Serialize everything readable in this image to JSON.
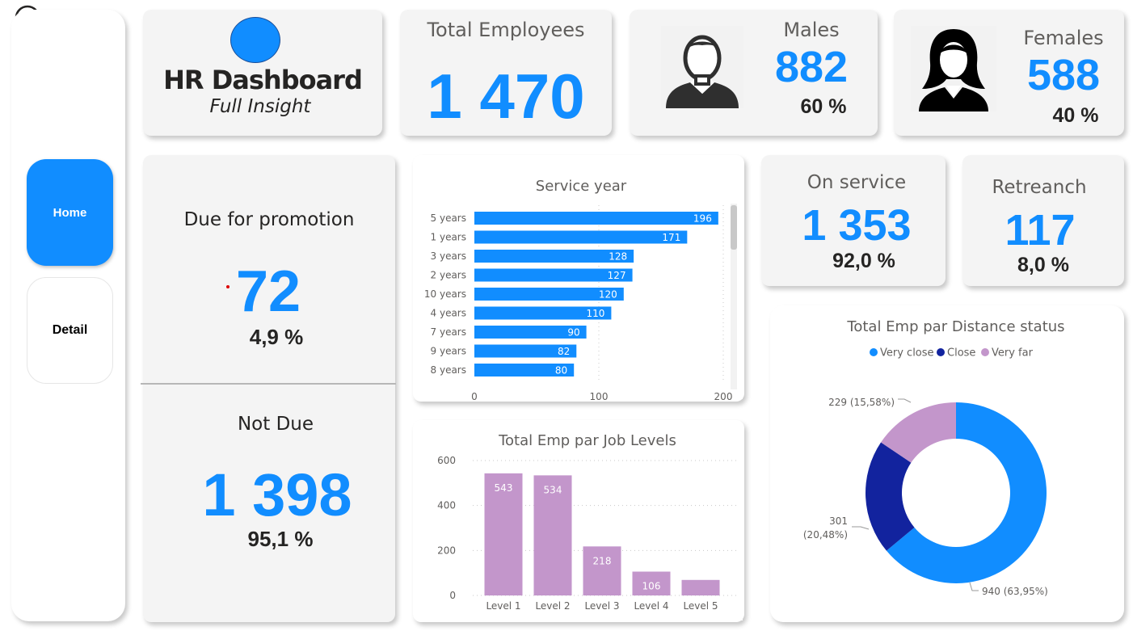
{
  "nav": {
    "back_icon": "back-arrow-icon",
    "home_label": "Home",
    "detail_label": "Detail"
  },
  "header": {
    "title": "HR Dashboard",
    "subtitle": "Full Insight"
  },
  "kpis": {
    "total_employees": {
      "label": "Total Employees",
      "value": "1 470"
    },
    "males": {
      "label": "Males",
      "value": "882",
      "percent": "60 %",
      "icon": "male-avatar-icon"
    },
    "females": {
      "label": "Females",
      "value": "588",
      "percent": "40 %",
      "icon": "female-avatar-icon"
    },
    "due_for_promotion": {
      "label": "Due for promotion",
      "value": "72",
      "percent": "4,9 %"
    },
    "not_due": {
      "label": "Not Due",
      "value": "1 398",
      "percent": "95,1 %"
    },
    "on_service": {
      "label": "On service",
      "value": "1 353",
      "percent": "92,0 %"
    },
    "retreanch": {
      "label": "Retreanch",
      "value": "117",
      "percent": "8,0 %"
    }
  },
  "colors": {
    "accent": "#118dff",
    "dark_blue": "#12239e",
    "purple": "#c396cb",
    "text_dark": "#252423",
    "text_gray": "#605e5c"
  },
  "chart_data": [
    {
      "type": "bar",
      "orientation": "horizontal",
      "title": "Service year",
      "categories": [
        "5 years",
        "1 years",
        "3 years",
        "2 years",
        "10 years",
        "4 years",
        "7 years",
        "9 years",
        "8 years"
      ],
      "values": [
        196,
        171,
        128,
        127,
        120,
        110,
        90,
        82,
        80
      ],
      "x_ticks": [
        "0",
        "100",
        "200"
      ],
      "xlim": [
        0,
        200
      ],
      "color": "#118dff"
    },
    {
      "type": "bar",
      "title": "Total Emp par Job Levels",
      "categories": [
        "Level 1",
        "Level 2",
        "Level 3",
        "Level 4",
        "Level 5"
      ],
      "values": [
        543,
        534,
        218,
        106,
        69
      ],
      "data_labels": [
        "543",
        "534",
        "218",
        "106",
        ""
      ],
      "y_ticks": [
        "600",
        "400",
        "200",
        "0"
      ],
      "ylim": [
        0,
        600
      ],
      "color": "#c396cb"
    },
    {
      "type": "pie",
      "donut": true,
      "title": "Total Emp par Distance status",
      "legend": [
        "Very close",
        "Close",
        "Very far"
      ],
      "legend_position": "top",
      "slices": [
        {
          "name": "Very close",
          "value": 940,
          "label": "940 (63,95%)",
          "color": "#118dff"
        },
        {
          "name": "Close",
          "value": 301,
          "label_line1": "301",
          "label_line2": "(20,48%)",
          "color": "#12239e"
        },
        {
          "name": "Very far",
          "value": 229,
          "label": "229 (15,58%)",
          "color": "#c396cb"
        }
      ]
    }
  ]
}
